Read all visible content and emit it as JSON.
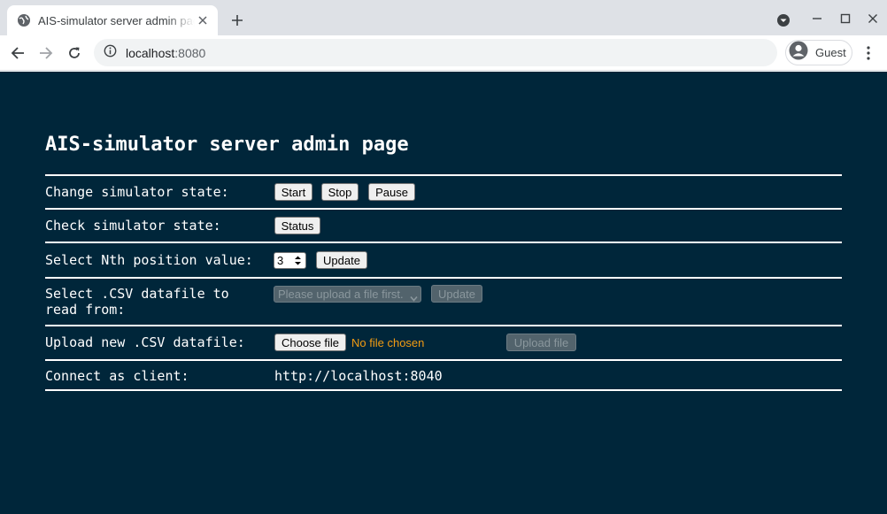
{
  "browser": {
    "tab_title": "AIS-simulator server admin page",
    "url_host": "localhost",
    "url_port": ":8080",
    "profile_label": "Guest"
  },
  "page": {
    "title": "AIS-simulator server admin page",
    "rows": {
      "state": {
        "label": "Change simulator state:",
        "start": "Start",
        "stop": "Stop",
        "pause": "Pause"
      },
      "check": {
        "label": "Check simulator state:",
        "status": "Status"
      },
      "nth": {
        "label": "Select Nth position value:",
        "value": "3",
        "update": "Update"
      },
      "csv_select": {
        "label_line1": "Select .CSV datafile to",
        "label_line2": "read from:",
        "placeholder": "Please upload a file first.",
        "update": "Update"
      },
      "upload": {
        "label": "Upload new .CSV datafile:",
        "choose": "Choose file",
        "no_file": "No file chosen",
        "upload": "Upload file"
      },
      "client": {
        "label": "Connect as client:",
        "url": "http://localhost:8040"
      }
    }
  },
  "colors": {
    "page_background": "#00263a",
    "text": "#ffffff",
    "no_file_text": "#f39c12"
  }
}
